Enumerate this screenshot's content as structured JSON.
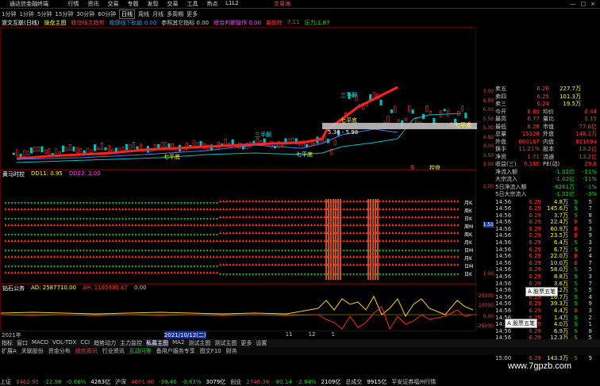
{
  "window": {
    "app_title": "通达信金融终端",
    "menus": [
      "行情",
      "资讯",
      "交易",
      "专题",
      "发现",
      "交易",
      "工具",
      "热点",
      "L1L2"
    ],
    "stock_label": "文易海",
    "controls": [
      "—",
      "□",
      "×"
    ]
  },
  "periods": {
    "items": [
      "1分钟",
      "1分钟",
      "5分钟",
      "15分钟",
      "30分钟",
      "60分钟",
      "日线",
      "周线",
      "月线",
      "多周期",
      "更多"
    ],
    "active_index": 6
  },
  "indicator_line": {
    "name": "浙文互联(日线)",
    "formula": "操盘主图",
    "items": [
      {
        "text": "稳住线主趋势",
        "color": "#ff3030"
      },
      {
        "text": "稳健线下轨助 0.00",
        "color": "#00a0ff"
      },
      {
        "text": "参照其它指标 0.00",
        "color": "#ccc"
      },
      {
        "text": "综合判断操作 0.00",
        "color": "#ff40ff"
      },
      {
        "text": "量能柱",
        "color": "#ff3030"
      },
      {
        "text": "7.11",
        "color": "#ff3030"
      },
      {
        "text": "压力:1.87",
        "color": "#00e000"
      }
    ]
  },
  "main_chart": {
    "price_ticks": [
      "7.00",
      "6.50",
      "6.00",
      "5.50",
      "5.00",
      "4.50",
      "4.00",
      "3.50",
      "3.00"
    ],
    "annotations": [
      {
        "text": "三半翻",
        "color": "#00e0e0"
      },
      {
        "text": "七平底",
        "color": "#ffff00"
      },
      {
        "text": "七平底",
        "color": "#ffff00"
      },
      {
        "text": "5.36 - 5.98",
        "color": "#fff"
      },
      {
        "text": "七平底",
        "color": "#ffff00"
      },
      {
        "text": "三半翻",
        "color": "#00e0e0"
      },
      {
        "text": "七平底",
        "color": "#ffff00"
      }
    ],
    "bottom_tags": [
      "多",
      "控盘"
    ]
  },
  "sub1": {
    "name": "黄马时控",
    "values": [
      {
        "text": "DD11: 0.95",
        "color": "#ffff00"
      },
      {
        "text": "DD22: 2.00",
        "color": "#ff40ff"
      }
    ],
    "row_labels": [
      "月K",
      "周K",
      "日K",
      "周M",
      "周K",
      "月K",
      "日M",
      "月K",
      "日M",
      "日K"
    ],
    "axis_ticks": [
      "2.00",
      "1.51",
      "1.00"
    ]
  },
  "sub2": {
    "name": "钻石公务",
    "values": [
      {
        "text": "AD: 2587710.00",
        "color": "#ffff00"
      },
      {
        "text": "AH: 1165995.67",
        "color": "#ff3030"
      },
      {
        "text": "0.00",
        "color": "#ccc"
      }
    ],
    "axis_ticks": [
      "25000",
      "10000",
      "0.00",
      "-25000"
    ]
  },
  "quote": {
    "rows": [
      {
        "lab": "卖五",
        "price": "6.26",
        "vol": "227.7万"
      },
      {
        "lab": "卖四",
        "price": "6.25",
        "vol": "101.3万"
      },
      {
        "lab": "卖三",
        "price": "6.24",
        "vol": "19.5万"
      }
    ],
    "stats": [
      {
        "l1": "今开",
        "v1": "6.60",
        "l2": "均价",
        "v2": "6.44"
      },
      {
        "l1": "最高",
        "v1": "6.77",
        "l2": "量比",
        "v2": "1.15"
      },
      {
        "l1": "最低",
        "v1": "6.28",
        "l2": "市值",
        "v2": "77.6亿"
      },
      {
        "l1": "总量",
        "v1": "15328",
        "l2": "外盘",
        "v2": "148.2万"
      },
      {
        "l1": "外盘",
        "v1": "660167",
        "l2": "内盘",
        "v2": "821694"
      },
      {
        "l1": "换手",
        "v1": "11.21%",
        "l2": "股本",
        "v2": "13.2亿"
      },
      {
        "l1": "净资",
        "v1": "1.71",
        "l2": "流通",
        "v2": "13.2亿"
      },
      {
        "l1": "收益(三)",
        "v1": "0.160",
        "l2": "PE(动)",
        "v2": "29.6"
      }
    ],
    "flows": [
      {
        "lab": "净流入额",
        "val": "-1.02亿",
        "pct": "-11%"
      },
      {
        "lab": "大宗流入",
        "val": "-1.02亿",
        "pct": "-11%"
      },
      {
        "lab": "5日净流入额",
        "val": "-6261万",
        "pct": "-1%"
      },
      {
        "lab": "5日大宗流入",
        "val": "-1.02亿",
        "pct": "-3%"
      }
    ],
    "ticks": [
      {
        "t": "14:56",
        "p": "6.29",
        "v": "4.8万",
        "d": "S",
        "n": "5"
      },
      {
        "t": "14:56",
        "p": "6.29",
        "v": "145.6万",
        "d": "S",
        "n": "7"
      },
      {
        "t": "14:56",
        "p": "6.29",
        "v": "3.7万",
        "d": "S",
        "n": "8"
      },
      {
        "t": "14:56",
        "p": "6.29",
        "v": "22.4万",
        "d": "B",
        "n": "5"
      },
      {
        "t": "14:56",
        "p": "6.29",
        "v": "60.9万",
        "d": "B",
        "n": "3"
      },
      {
        "t": "14:56",
        "p": "6.29",
        "v": "23.5万",
        "d": "B",
        "n": "9"
      },
      {
        "t": "14:56",
        "p": "6.29",
        "v": "6.4万",
        "d": "S",
        "n": "3"
      },
      {
        "t": "14:56",
        "p": "6.29",
        "v": "6.7万",
        "d": "S",
        "n": "2"
      },
      {
        "t": "14:56",
        "p": "6.29",
        "v": "22.0万",
        "d": "B",
        "n": "4"
      },
      {
        "t": "14:56",
        "p": "6.29",
        "v": "10.0万",
        "d": "B",
        "n": "7"
      },
      {
        "t": "14:56",
        "p": "6.29",
        "v": "58.0万",
        "d": "S",
        "n": "5"
      },
      {
        "t": "14:56",
        "p": "6.29",
        "v": "8.8万",
        "d": "S",
        "n": "3"
      },
      {
        "t": "14:56",
        "p": "6.29",
        "v": "3.6万",
        "d": "S",
        "n": "7"
      },
      {
        "t": "14:56",
        "p": "6.29",
        "v": "6.2万",
        "d": "S",
        "n": "5"
      },
      {
        "t": "14:56",
        "p": "6.29",
        "v": "16.7万",
        "d": "S",
        "n": "4"
      },
      {
        "t": "14:56",
        "p": "6.29",
        "v": "39.3万",
        "d": "S",
        "n": "9"
      },
      {
        "t": "14:56",
        "p": "6.29",
        "v": "4.4万",
        "d": "B",
        "n": "3"
      },
      {
        "t": "14:56",
        "p": "6.29",
        "v": "1.4万",
        "d": "S",
        "n": "2"
      },
      {
        "t": "14:56",
        "p": "6.29",
        "v": "4.0万",
        "d": "S",
        "n": "1"
      },
      {
        "t": "14:56",
        "p": "6.29",
        "v": "6.9万",
        "d": "S",
        "n": "8"
      },
      {
        "t": "14:56",
        "p": "6.29",
        "v": "12.3万",
        "d": "S",
        "n": "5"
      },
      {
        "t": "14:56",
        "p": "6.29",
        "v": "8.5万",
        "d": "S",
        "n": "3"
      },
      {
        "t": "14:57",
        "p": "6.29",
        "v": "1.1万",
        "d": "S",
        "n": "2"
      },
      {
        "t": "15:00",
        "p": "6.29",
        "v": "143.3万",
        "d": "S",
        "n": "9"
      }
    ],
    "popup1": "A 股票五笔",
    "popup2": "A 股票五笔"
  },
  "dates": [
    "2021年",
    "2021/10/12(二)",
    "11",
    "12",
    "1"
  ],
  "tabs": [
    "指标",
    "窗口",
    "MACD",
    "VOL-TDX",
    "CCI",
    "趋势动力",
    "主力监控",
    "私募主图",
    "MA2",
    "测试主图",
    "测试主图",
    "更多",
    "设置"
  ],
  "tabs_selected": "私募主图",
  "tabs2": [
    "扩展A",
    "关联股份",
    "资金分布",
    "综合资讯",
    "行业资讯",
    "互动问答",
    "备用户服务专享",
    "图文F10",
    "财务"
  ],
  "status": [
    {
      "text": "上证",
      "color": "#ccc"
    },
    {
      "text": "3462.95",
      "color": "#ff3030"
    },
    {
      "text": "-22.96",
      "color": "#00e000"
    },
    {
      "text": "-0.66%",
      "color": "#00e000"
    },
    {
      "text": "4263亿",
      "color": "#fff"
    },
    {
      "text": "沪深",
      "color": "#ccc"
    },
    {
      "text": "4601.40",
      "color": "#ff3030"
    },
    {
      "text": "-38.46",
      "color": "#00e000"
    },
    {
      "text": "-0.83%",
      "color": "#00e000"
    },
    {
      "text": "3079亿",
      "color": "#fff"
    },
    {
      "text": "创业",
      "color": "#ccc"
    },
    {
      "text": "2746.38",
      "color": "#ff3030"
    },
    {
      "text": "-80.14",
      "color": "#00e000"
    },
    {
      "text": "-2.84%",
      "color": "#00e000"
    },
    {
      "text": "2109亿",
      "color": "#fff"
    },
    {
      "text": "总成交",
      "color": "#ccc"
    },
    {
      "text": "9915亿",
      "color": "#fff"
    },
    {
      "text": "平安证券福州行情",
      "color": "#ccc"
    }
  ],
  "watermark": "www.7gpzb.com",
  "colors": {
    "up": "#ff3030",
    "down": "#00e000",
    "volume": "#ffff00",
    "bg": "#000000"
  }
}
